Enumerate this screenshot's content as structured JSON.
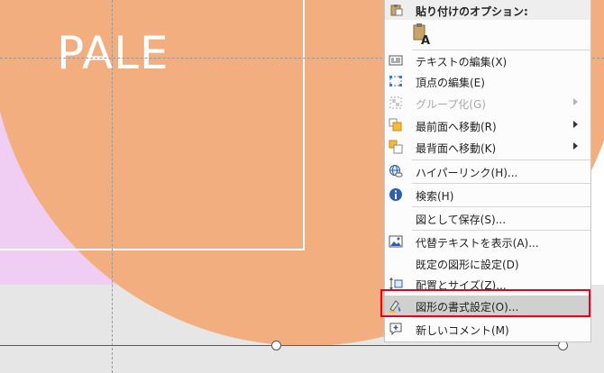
{
  "slide": {
    "text": "PALE",
    "colors": {
      "peach": "#f3ae80",
      "pink": "#f0cdf3",
      "frame": "#ffffff"
    }
  },
  "context_menu": {
    "paste_options_title": "貼り付けのオプション:",
    "paste_option_icon": "paste-keep-text-only-icon",
    "items": [
      {
        "label": "テキストの編集(X)",
        "icon": "edit-text-icon",
        "enabled": true,
        "submenu": false
      },
      {
        "label": "頂点の編集(E)",
        "icon": "edit-points-icon",
        "enabled": true,
        "submenu": false
      },
      {
        "label": "グループ化(G)",
        "icon": "group-icon",
        "enabled": false,
        "submenu": true
      },
      {
        "label": "最前面へ移動(R)",
        "icon": "bring-to-front-icon",
        "enabled": true,
        "submenu": true
      },
      {
        "label": "最背面へ移動(K)",
        "icon": "send-to-back-icon",
        "enabled": true,
        "submenu": true
      },
      {
        "label": "ハイパーリンク(H)...",
        "icon": "hyperlink-icon",
        "enabled": true,
        "submenu": false
      },
      {
        "label": "検索(H)",
        "icon": "search-info-icon",
        "enabled": true,
        "submenu": false
      },
      {
        "label": "図として保存(S)...",
        "icon": "",
        "enabled": true,
        "submenu": false
      },
      {
        "label": "代替テキストを表示(A)...",
        "icon": "alt-text-icon",
        "enabled": true,
        "submenu": false
      },
      {
        "label": "既定の図形に設定(D)",
        "icon": "",
        "enabled": true,
        "submenu": false
      },
      {
        "label": "配置とサイズ(Z)...",
        "icon": "size-position-icon",
        "enabled": true,
        "submenu": false
      },
      {
        "label": "図形の書式設定(O)...",
        "icon": "format-shape-icon",
        "enabled": true,
        "submenu": false,
        "highlighted": true
      },
      {
        "label": "新しいコメント(M)",
        "icon": "new-comment-icon",
        "enabled": true,
        "submenu": false
      }
    ],
    "highlight_color": "#e8001c"
  }
}
